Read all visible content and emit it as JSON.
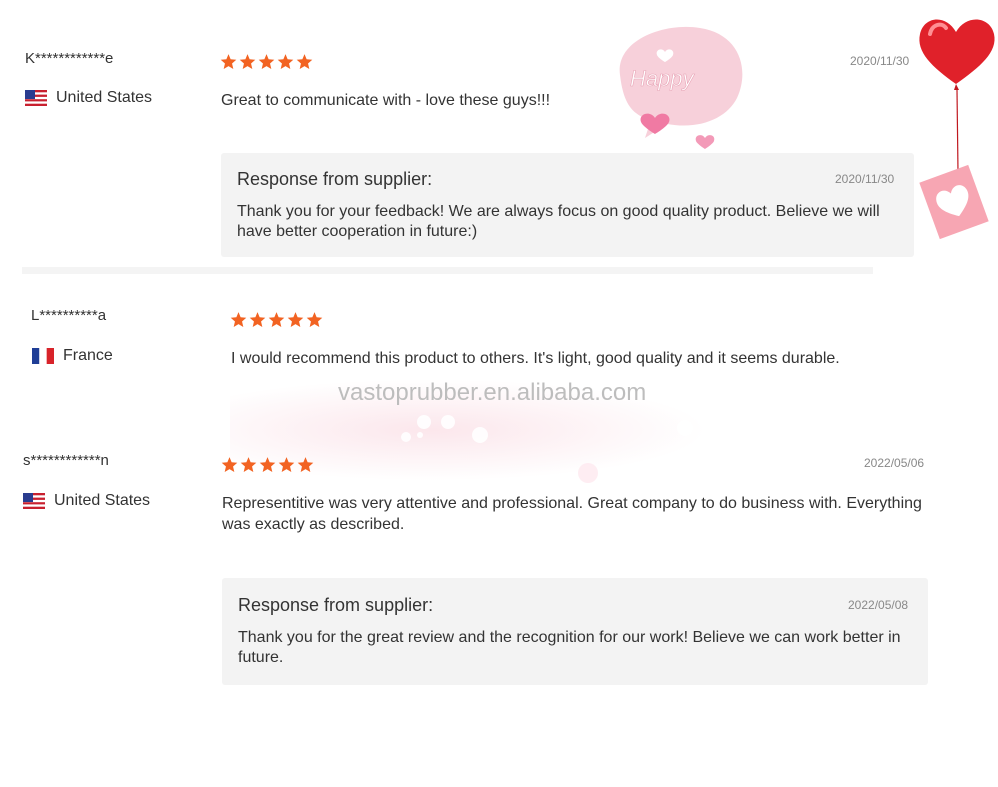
{
  "reviews": [
    {
      "name": "K************e",
      "country": "United States",
      "flag": "us-flag",
      "rating": 5,
      "comment": "Great to communicate with - love these guys!!!",
      "date": "2020/11/30",
      "response": {
        "title": "Response from supplier:",
        "date": "2020/11/30",
        "text": "Thank you for your feedback! We are always focus on good quality product. Believe we will have better cooperation in future:)"
      }
    },
    {
      "name": "L**********a",
      "country": "France",
      "flag": "fr-flag",
      "rating": 5,
      "comment": "I would recommend this product to others. It's light, good quality and it seems durable."
    },
    {
      "name": "s************n",
      "country": "United States",
      "flag": "us-flag",
      "rating": 5,
      "comment": "Representitive was very attentive and professional. Great company to do business with. Everything was exactly as described.",
      "date": "2022/05/06",
      "response": {
        "title": "Response from supplier:",
        "date": "2022/05/08",
        "text": "Thank you for the great review and the recognition for our work! Believe we can work better in future."
      }
    }
  ],
  "decor": {
    "happy_text": "Happy"
  },
  "watermark": "vastoprubber.en.alibaba.com",
  "colors": {
    "star": "#f26322",
    "response_bg": "#f3f3f3",
    "heart_red": "#e0212a"
  }
}
